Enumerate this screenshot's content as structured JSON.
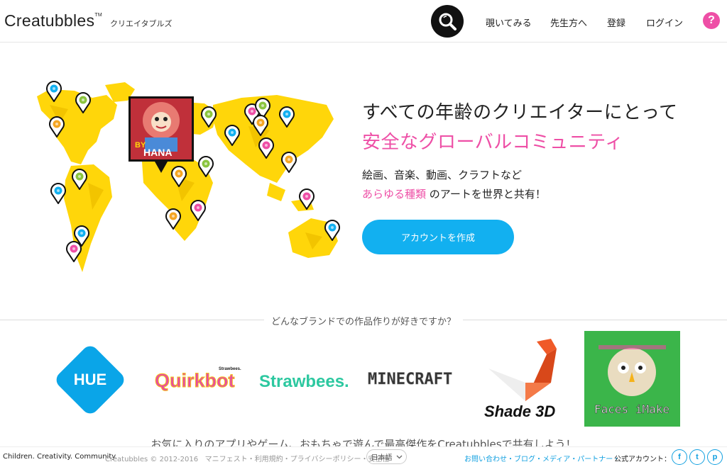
{
  "header": {
    "logo": "Creatubbles",
    "logo_tm": "TM",
    "logo_jp": "クリエイタブルズ",
    "search_icon": "search-icon",
    "nav": [
      "覗いてみる",
      "先生方へ",
      "登録",
      "ログイン"
    ],
    "help": "?"
  },
  "hero": {
    "title": "すべての年齢のクリエイターにとって",
    "subtitle": "安全なグローバルコミュニティ",
    "line1": "絵画、音楽、動画、クラフトなど",
    "line2_highlight": "あらゆる種類",
    "line2_rest": " のアートを世界と共有！",
    "cta": "アカウントを作成",
    "featured_art_caption": "BY HANA"
  },
  "brands": {
    "heading": "どんなブランドでの作品作りが好きですか？",
    "items": [
      "HUE",
      "Quirkbot",
      "Strawbees",
      "Minecraft",
      "Shade 3D",
      "Faces iMake"
    ],
    "quirkbot_badge": "Strawbees",
    "faces_label": "Faces iMake",
    "share_text": "お気に入りのアプリやゲーム、おもちゃで遊んで最高傑作をCreatubblesで共有しよう！"
  },
  "footer": {
    "tagline": "Children. Creativity. Community.",
    "copyright": "Creatubbles © 2012-2016",
    "links_left": "マニフェスト・利用規約・プライバシーポリシー・安全性",
    "language": "日本語",
    "links_right": "お問い合わせ・ブログ・メディア・パートナー・",
    "official_accounts": "公式アカウント：",
    "social": [
      "f",
      "t",
      "p"
    ]
  },
  "colors": {
    "accent_pink": "#ee4fa6",
    "accent_blue": "#12b0f0",
    "map_yellow": "#ffd60a",
    "hue_blue": "#0aa5e8",
    "strawbees_green": "#2dc8a0",
    "shade_orange": "#f05a28"
  }
}
